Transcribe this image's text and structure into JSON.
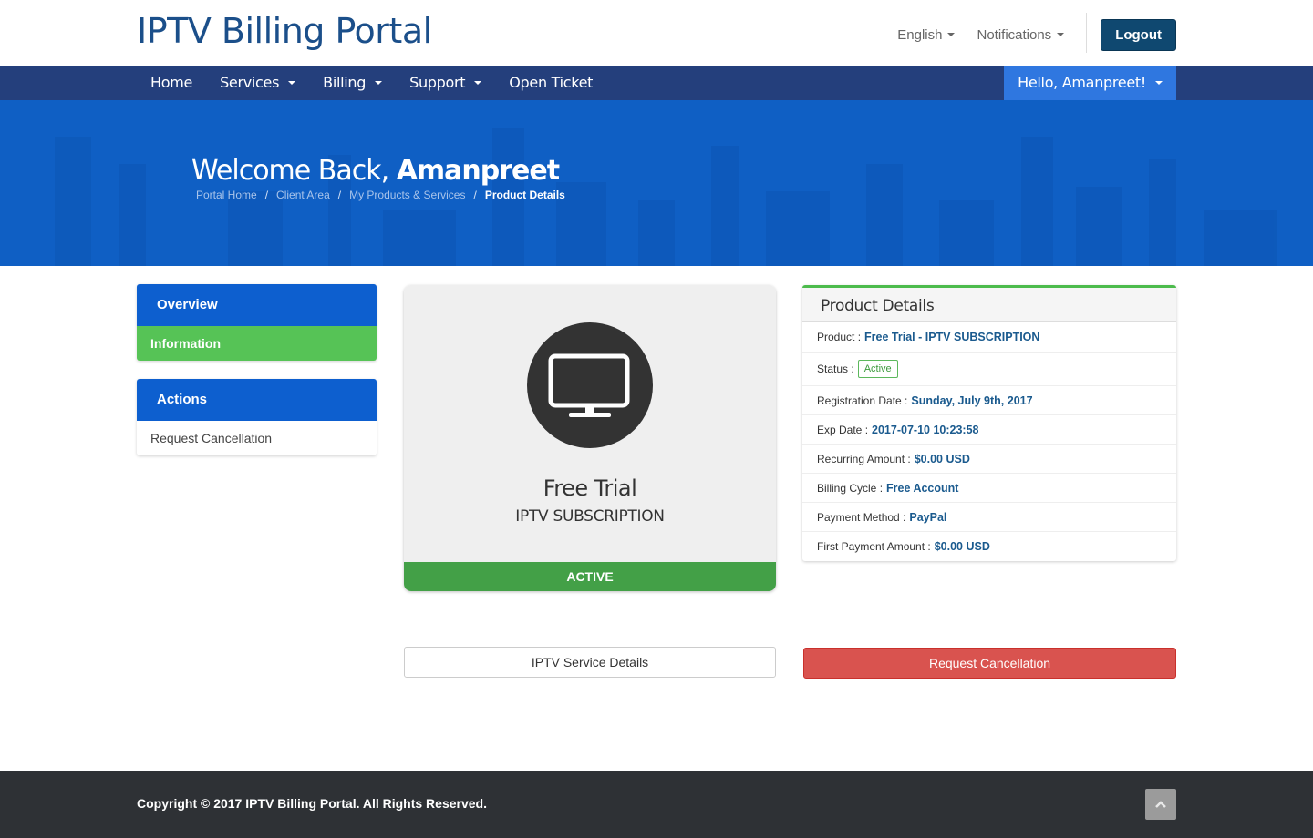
{
  "header": {
    "brand": "IPTV Billing Portal",
    "language": "English",
    "notifications": "Notifications",
    "logout": "Logout"
  },
  "nav": {
    "items": [
      {
        "label": "Home"
      },
      {
        "label": "Services"
      },
      {
        "label": "Billing"
      },
      {
        "label": "Support"
      },
      {
        "label": "Open Ticket"
      }
    ],
    "user": "Hello, Amanpreet!"
  },
  "hero": {
    "welcome": "Welcome Back,",
    "name": "Amanpreet",
    "breadcrumb": [
      "Portal Home",
      "Client Area",
      "My Products & Services",
      "Product Details"
    ],
    "separator": "/"
  },
  "sidebar": {
    "overview": {
      "title": "Overview",
      "items": [
        "Information"
      ]
    },
    "actions": {
      "title": "Actions",
      "items": [
        "Request Cancellation"
      ]
    }
  },
  "product": {
    "icon": "monitor-icon",
    "name": "Free Trial",
    "group": "IPTV SUBSCRIPTION",
    "status": "ACTIVE"
  },
  "details": {
    "title": "Product Details",
    "rows": [
      {
        "label": "Product :",
        "value": "Free Trial - IPTV SUBSCRIPTION"
      },
      {
        "label": "Status :",
        "value": "Active"
      },
      {
        "label": "Registration Date :",
        "value": "Sunday, July 9th, 2017"
      },
      {
        "label": "Exp Date :",
        "value": "2017-07-10 10:23:58"
      },
      {
        "label": "Recurring Amount :",
        "value": "$0.00 USD"
      },
      {
        "label": "Billing Cycle :",
        "value": "Free Account"
      },
      {
        "label": "Payment Method :",
        "value": "PayPal"
      },
      {
        "label": "First Payment Amount :",
        "value": "$0.00 USD"
      }
    ]
  },
  "buttons": {
    "service_details": "IPTV Service Details",
    "request_cancellation": "Request Cancellation"
  },
  "footer": {
    "copyright": "Copyright © 2017 IPTV Billing Portal. All Rights Reserved.",
    "back_to_top_icon": "chevron-up-icon"
  },
  "colors": {
    "brand": "#1b4f8a",
    "navbar": "#243f7c",
    "hero": "#0f5fc4",
    "active_green": "#43a047",
    "danger": "#d9534f"
  }
}
